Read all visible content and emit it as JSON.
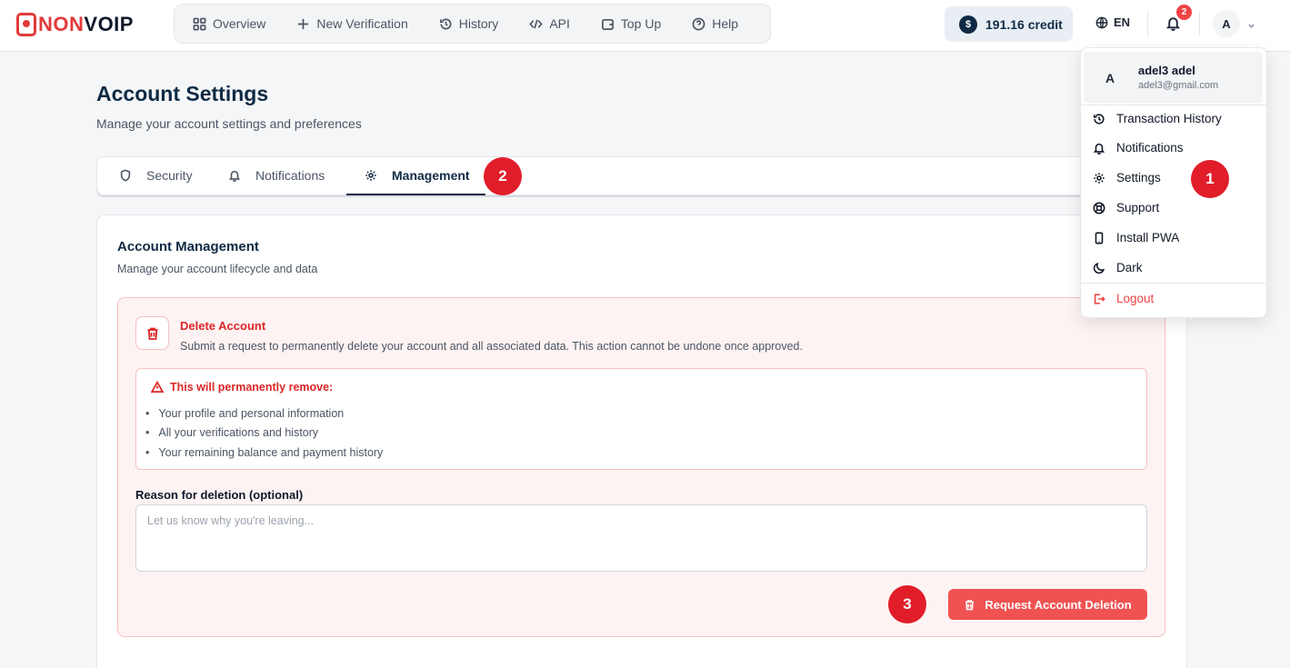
{
  "brand": {
    "logo_left": "NON",
    "logo_right": "VOIP"
  },
  "nav": {
    "items": [
      {
        "label": "Overview",
        "icon": "grid-icon"
      },
      {
        "label": "New Verification",
        "icon": "plus-icon"
      },
      {
        "label": "History",
        "icon": "history-icon"
      },
      {
        "label": "API",
        "icon": "code-icon"
      },
      {
        "label": "Top Up",
        "icon": "wallet-icon"
      },
      {
        "label": "Help",
        "icon": "help-circle-icon"
      }
    ]
  },
  "header": {
    "credit_symbol": "$",
    "credit_label": "191.16 credit",
    "language": "EN",
    "notification_count": "2",
    "avatar_initial": "A"
  },
  "page": {
    "title": "Account Settings",
    "subtitle": "Manage your account settings and preferences"
  },
  "tabs": [
    {
      "label": "Security",
      "icon": "shield-icon",
      "active": false
    },
    {
      "label": "Notifications",
      "icon": "bell-icon",
      "active": false
    },
    {
      "label": "Management",
      "icon": "gear-icon",
      "active": true
    }
  ],
  "management": {
    "title": "Account Management",
    "subtitle": "Manage your account lifecycle and data",
    "delete_title": "Delete Account",
    "delete_description": "Submit a request to permanently delete your account and all associated data. This action cannot be undone once approved.",
    "warning_title": "This will permanently remove:",
    "warning_items": [
      "Your profile and personal information",
      "All your verifications and history",
      "Your remaining balance and payment history"
    ],
    "reason_label": "Reason for deletion (optional)",
    "reason_placeholder": "Let us know why you're leaving...",
    "reason_value": "",
    "submit_label": "Request Account Deletion"
  },
  "user_menu": {
    "initial": "A",
    "name": "adel3 adel",
    "email": "adel3@gmail.com",
    "items": [
      {
        "label": "Transaction History",
        "icon": "history-icon"
      },
      {
        "label": "Notifications",
        "icon": "bell-icon"
      },
      {
        "label": "Settings",
        "icon": "gear-icon"
      },
      {
        "label": "Support",
        "icon": "lifebuoy-icon"
      },
      {
        "label": "Install PWA",
        "icon": "phone-icon"
      },
      {
        "label": "Dark",
        "icon": "moon-icon"
      }
    ],
    "logout_label": "Logout"
  },
  "step_markers": [
    "1",
    "2",
    "3"
  ],
  "colors": {
    "brand_red": "#e23a3a",
    "navy": "#0f2a44",
    "danger": "#dc2626",
    "danger_button": "#f05252",
    "marker": "#e11d2a"
  }
}
